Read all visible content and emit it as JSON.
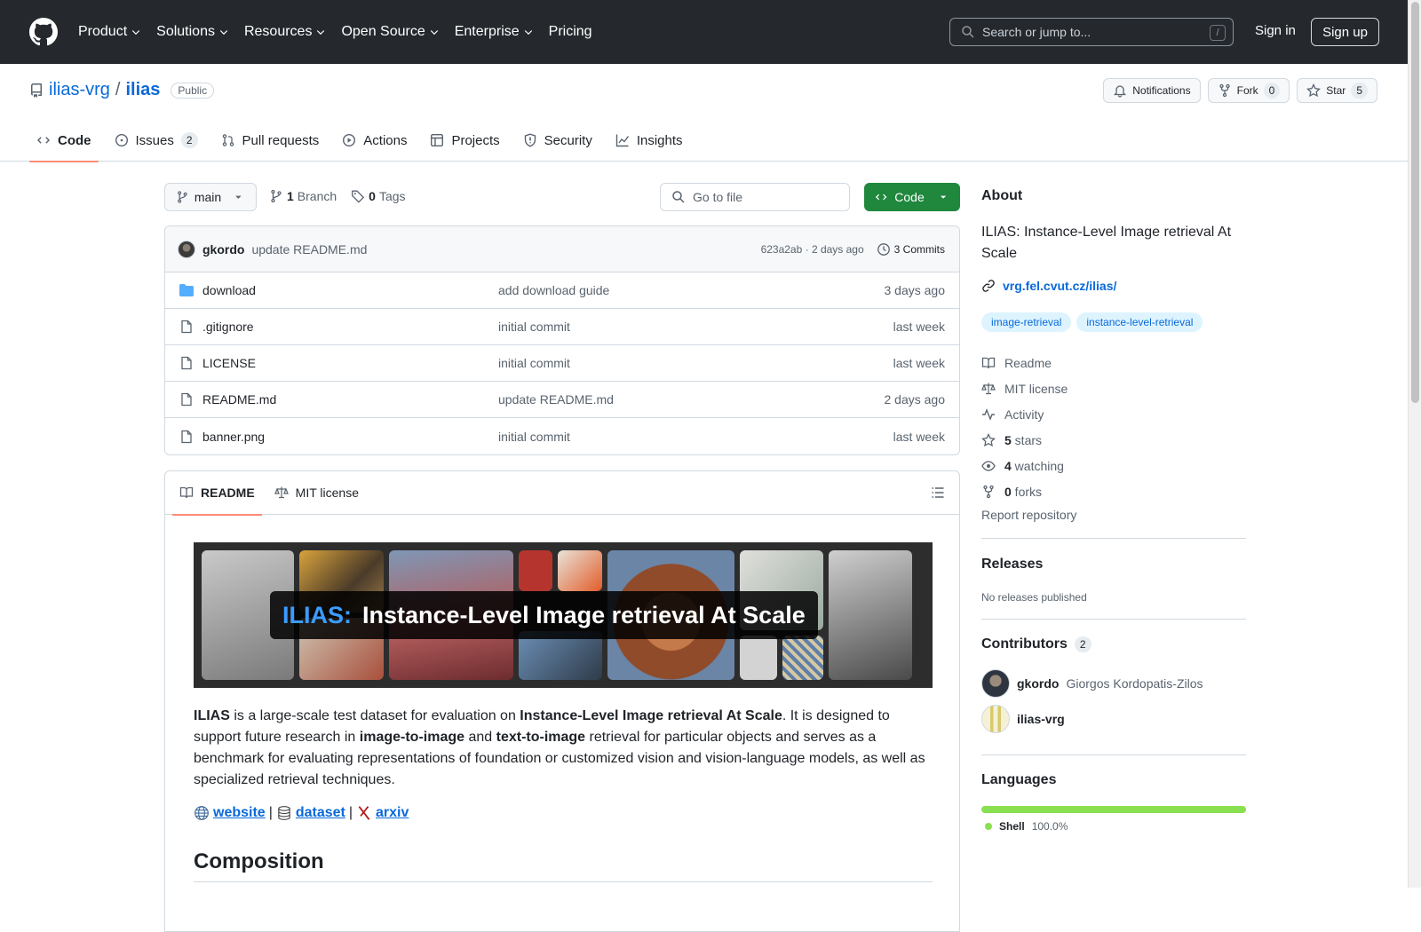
{
  "header": {
    "nav": [
      {
        "label": "Product",
        "dropdown": true
      },
      {
        "label": "Solutions",
        "dropdown": true
      },
      {
        "label": "Resources",
        "dropdown": true
      },
      {
        "label": "Open Source",
        "dropdown": true
      },
      {
        "label": "Enterprise",
        "dropdown": true
      },
      {
        "label": "Pricing",
        "dropdown": false
      }
    ],
    "search_placeholder": "Search or jump to...",
    "search_kbd": "/",
    "signin": "Sign in",
    "signup": "Sign up"
  },
  "repo": {
    "owner": "ilias-vrg",
    "separator": "/",
    "name": "ilias",
    "visibility": "Public",
    "notifications": "Notifications",
    "fork": "Fork",
    "fork_count": "0",
    "star": "Star",
    "star_count": "5"
  },
  "tabs": [
    {
      "label": "Code",
      "icon": "code-icon",
      "active": true,
      "count": ""
    },
    {
      "label": "Issues",
      "icon": "issue-icon",
      "active": false,
      "count": "2"
    },
    {
      "label": "Pull requests",
      "icon": "pull-request-icon",
      "active": false,
      "count": ""
    },
    {
      "label": "Actions",
      "icon": "play-icon",
      "active": false,
      "count": ""
    },
    {
      "label": "Projects",
      "icon": "table-icon",
      "active": false,
      "count": ""
    },
    {
      "label": "Security",
      "icon": "shield-icon",
      "active": false,
      "count": ""
    },
    {
      "label": "Insights",
      "icon": "graph-icon",
      "active": false,
      "count": ""
    }
  ],
  "toolbar": {
    "branch": "main",
    "branch_count": "1",
    "branch_label": "Branch",
    "tag_count": "0",
    "tag_label": "Tags",
    "goto_placeholder": "Go to file",
    "code_button": "Code"
  },
  "commit": {
    "author": "gkordo",
    "message": "update README.md",
    "hash_time": "623a2ab · 2 days ago",
    "commits": "3 Commits"
  },
  "files": [
    {
      "name": "download",
      "type": "folder",
      "message": "add download guide",
      "time": "3 days ago"
    },
    {
      "name": ".gitignore",
      "type": "file",
      "message": "initial commit",
      "time": "last week"
    },
    {
      "name": "LICENSE",
      "type": "file",
      "message": "initial commit",
      "time": "last week"
    },
    {
      "name": "README.md",
      "type": "file",
      "message": "update README.md",
      "time": "2 days ago"
    },
    {
      "name": "banner.png",
      "type": "file",
      "message": "initial commit",
      "time": "last week"
    }
  ],
  "readme": {
    "tab_readme": "README",
    "tab_license": "MIT license",
    "banner_accent": "ILIAS:",
    "banner_title": "Instance-Level Image retrieval At Scale",
    "intro": {
      "p1_bold": "ILIAS",
      "p1": " is a large-scale test dataset for evaluation on ",
      "p2_bold": "Instance-Level Image retrieval At Scale",
      "p2": ". It is designed to support future research in ",
      "p3_bold": "image-to-image",
      "p3": " and ",
      "p4_bold": "text-to-image",
      "p4": " retrieval for particular objects and serves as a benchmark for evaluating representations of foundation or customized vision and vision-language models, as well as specialized retrieval techniques."
    },
    "links": {
      "website": "website",
      "dataset": "dataset",
      "arxiv": "arxiv",
      "sep": "|"
    },
    "h2": "Composition"
  },
  "about": {
    "title": "About",
    "description": "ILIAS: Instance-Level Image retrieval At Scale",
    "link": "vrg.fel.cvut.cz/ilias/",
    "topics": [
      "image-retrieval",
      "instance-level-retrieval"
    ],
    "meta": [
      {
        "icon": "book-icon",
        "bold": "",
        "label": "Readme"
      },
      {
        "icon": "law-icon",
        "bold": "",
        "label": "MIT license"
      },
      {
        "icon": "pulse-icon",
        "bold": "",
        "label": "Activity"
      },
      {
        "icon": "star-icon",
        "bold": "5",
        "label": " stars"
      },
      {
        "icon": "eye-icon",
        "bold": "4",
        "label": " watching"
      },
      {
        "icon": "fork-icon",
        "bold": "0",
        "label": " forks"
      }
    ],
    "report": "Report repository"
  },
  "releases": {
    "title": "Releases",
    "empty": "No releases published"
  },
  "contributors": {
    "title": "Contributors",
    "count": "2",
    "list": [
      {
        "login": "gkordo",
        "name": "Giorgos Kordopatis-Zilos"
      },
      {
        "login": "ilias-vrg",
        "name": ""
      }
    ]
  },
  "languages": {
    "title": "Languages",
    "items": [
      {
        "name": "Shell",
        "percent": "100.0%",
        "color": "#89e051"
      }
    ]
  },
  "colors": {
    "accent": "#0969da",
    "header_bg": "#25292e",
    "code_green": "#1f883d",
    "tab_underline": "#fd8c73"
  }
}
